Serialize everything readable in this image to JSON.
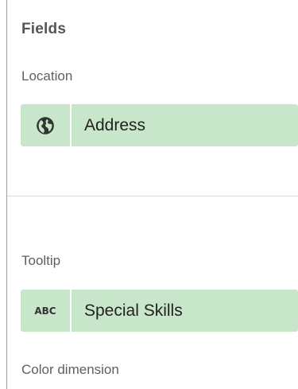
{
  "fields": {
    "title": "Fields",
    "location": {
      "label": "Location",
      "pill": {
        "icon": "globe-icon",
        "text": "Address"
      }
    },
    "tooltip": {
      "label": "Tooltip",
      "pill": {
        "icon": "abc-icon",
        "icon_text": "ABC",
        "text": "Special Skills"
      }
    },
    "color_dimension": {
      "label": "Color dimension"
    }
  },
  "colors": {
    "pill_background": "#c8e6c9",
    "divider": "#d9d9d9"
  }
}
